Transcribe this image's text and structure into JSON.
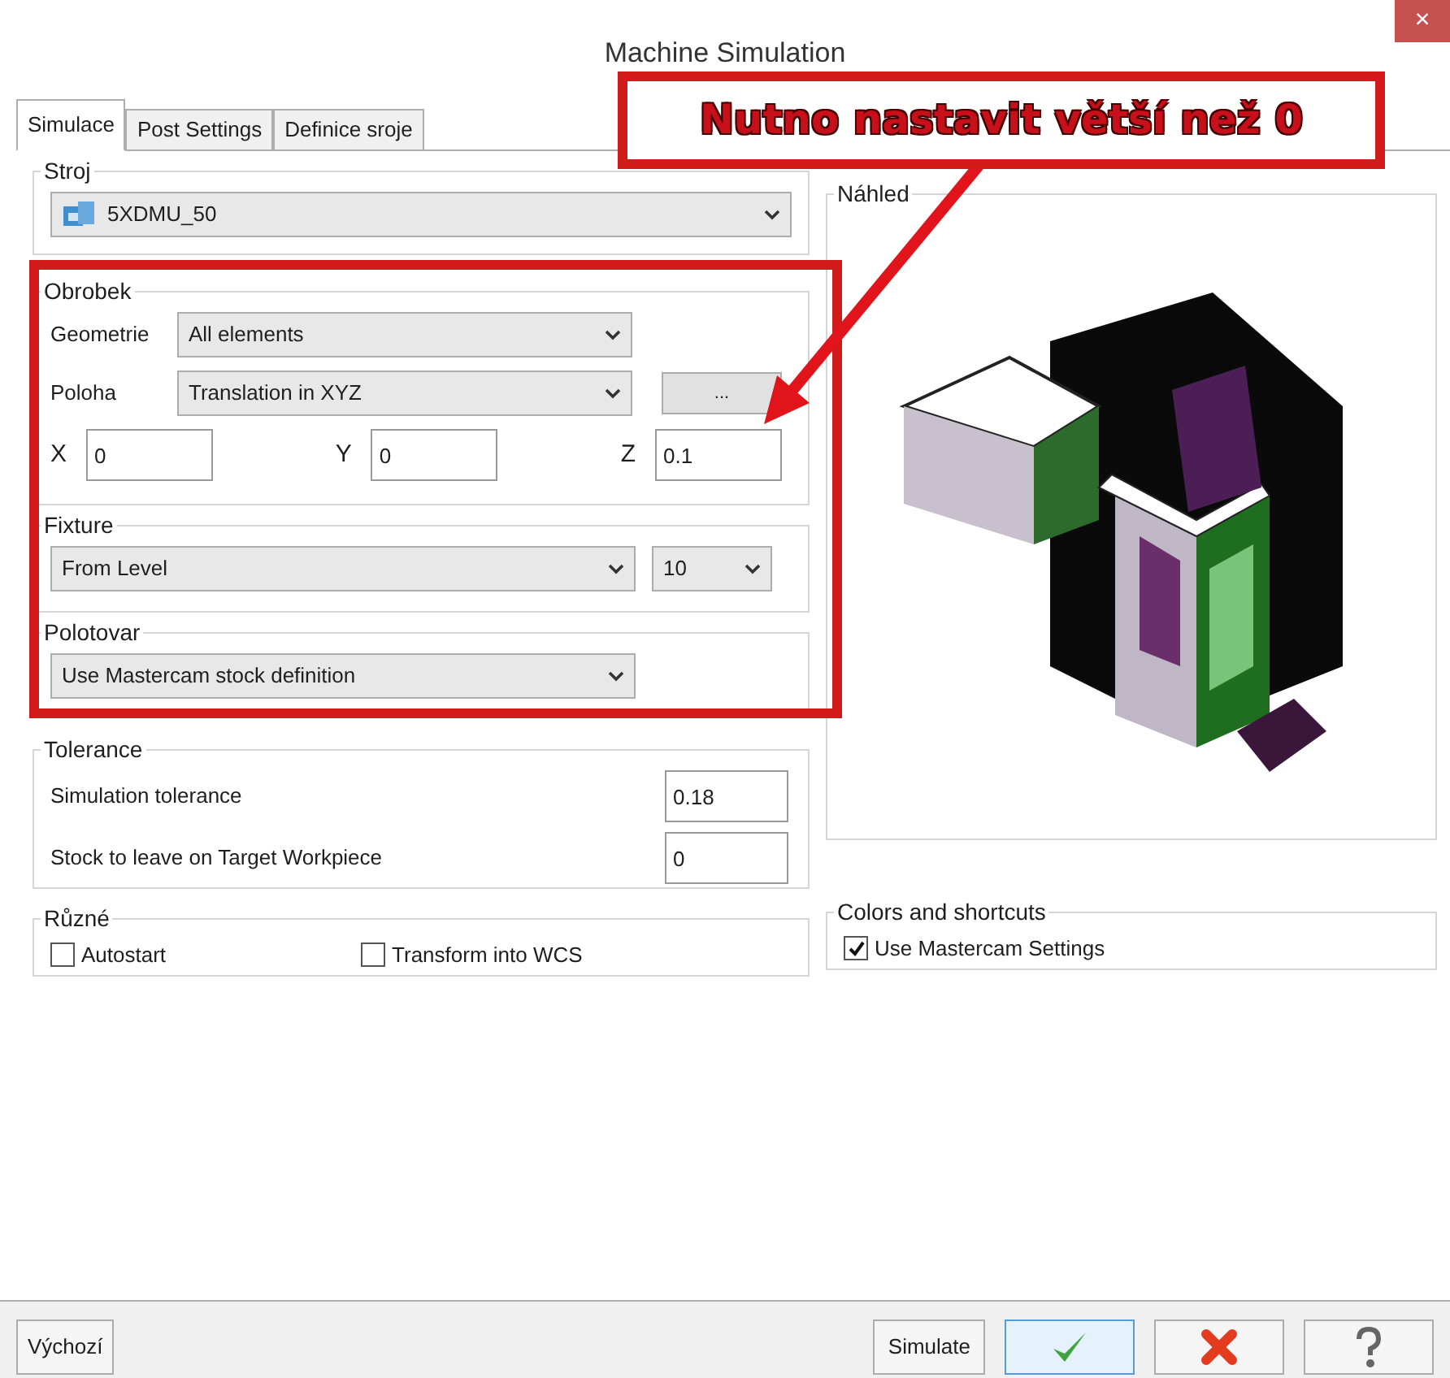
{
  "window": {
    "title": "Machine Simulation",
    "close": "×"
  },
  "tabs": [
    {
      "label": "Simulace",
      "selected": true
    },
    {
      "label": "Post Settings",
      "selected": false
    },
    {
      "label": "Definice sroje",
      "selected": false
    }
  ],
  "stroj": {
    "label": "Stroj",
    "machine": "5XDMU_50"
  },
  "obrobek": {
    "label": "Obrobek",
    "geometrie": {
      "label": "Geometrie",
      "value": "All elements"
    },
    "poloha": {
      "label": "Poloha",
      "value": "Translation in XYZ",
      "button": "..."
    },
    "coords": [
      {
        "label": "X",
        "value": "0"
      },
      {
        "label": "Y",
        "value": "0"
      },
      {
        "label": "Z",
        "value": "0.1"
      }
    ]
  },
  "fixture": {
    "label": "Fixture",
    "value": "From Level",
    "level_value": "10"
  },
  "polotovar": {
    "label": "Polotovar",
    "value": "Use Mastercam stock definition"
  },
  "tolerance": {
    "label": "Tolerance",
    "rows": [
      {
        "label": "Simulation tolerance",
        "value": "0.18"
      },
      {
        "label": "Stock to leave on Target Workpiece",
        "value": "0"
      }
    ]
  },
  "ruzne": {
    "label": "Různé",
    "checkboxes": [
      {
        "label": "Autostart",
        "checked": false
      },
      {
        "label": "Transform into WCS",
        "checked": false
      }
    ]
  },
  "preview": {
    "label": "Náhled",
    "kind": "picture"
  },
  "colors": {
    "label": "Colors and shortcuts",
    "checkboxes": [
      {
        "label": "Use Mastercam Settings",
        "checked": true
      }
    ]
  },
  "footer": {
    "default_button": "Výchozí",
    "simulate_button": "Simulate"
  },
  "annotation": {
    "text": "Nutno nastavit větší než 0"
  }
}
